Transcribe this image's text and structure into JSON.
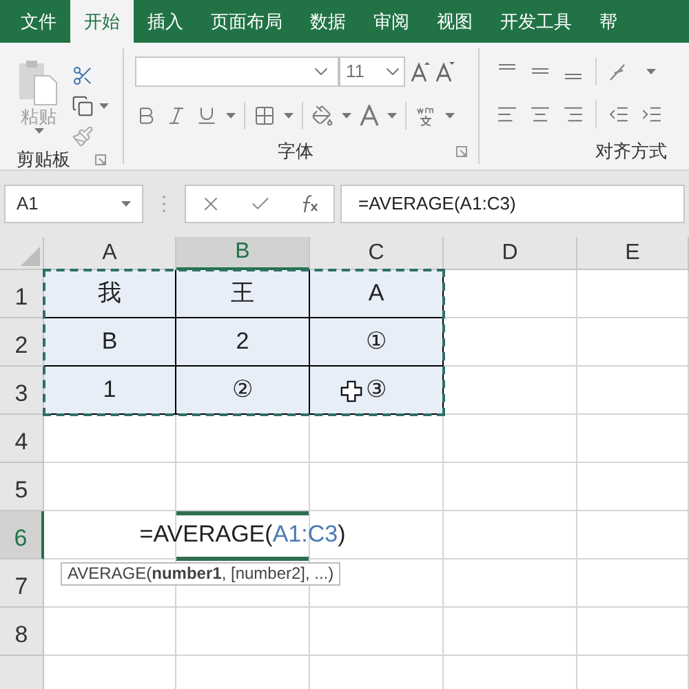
{
  "tabs": [
    {
      "label": "文件",
      "selected": false
    },
    {
      "label": "开始",
      "selected": true
    },
    {
      "label": "插入",
      "selected": false
    },
    {
      "label": "页面布局",
      "selected": false
    },
    {
      "label": "数据",
      "selected": false
    },
    {
      "label": "审阅",
      "selected": false
    },
    {
      "label": "视图",
      "selected": false
    },
    {
      "label": "开发工具",
      "selected": false
    },
    {
      "label": "帮",
      "selected": false
    }
  ],
  "ribbon": {
    "paste_label": "粘贴",
    "paste_disabled": true,
    "font_size": "11",
    "groups": [
      "剪贴板",
      "字体",
      "对齐方式"
    ]
  },
  "formula_bar": {
    "name_box": "A1",
    "formula": "=AVERAGE(A1:C3)"
  },
  "columns": [
    {
      "label": "A",
      "selected": false
    },
    {
      "label": "B",
      "selected": true
    },
    {
      "label": "C",
      "selected": false
    },
    {
      "label": "D",
      "selected": false
    },
    {
      "label": "E",
      "selected": false
    }
  ],
  "rows": [
    {
      "label": "1",
      "selected": false,
      "cells": [
        {
          "kind": "value",
          "text": "我",
          "highlighted": true
        },
        {
          "kind": "value",
          "text": "王",
          "highlighted": true
        },
        {
          "kind": "value",
          "text": "A",
          "highlighted": true
        },
        {
          "kind": "value"
        },
        {
          "kind": "value"
        }
      ]
    },
    {
      "label": "2",
      "selected": false,
      "cells": [
        {
          "kind": "value",
          "text": "B",
          "highlighted": true
        },
        {
          "kind": "value",
          "text": "2",
          "highlighted": true
        },
        {
          "kind": "value",
          "text": "①",
          "highlighted": true
        },
        {
          "kind": "value"
        },
        {
          "kind": "value"
        }
      ]
    },
    {
      "label": "3",
      "selected": false,
      "cells": [
        {
          "kind": "value",
          "text": "1",
          "highlighted": true
        },
        {
          "kind": "value",
          "text": "②",
          "highlighted": true
        },
        {
          "kind": "value",
          "text": "③",
          "highlighted": true,
          "cursor": true
        },
        {
          "kind": "value"
        },
        {
          "kind": "value"
        }
      ]
    },
    {
      "label": "4",
      "selected": false,
      "cells": [
        {
          "kind": "value"
        },
        {
          "kind": "value"
        },
        {
          "kind": "value"
        },
        {
          "kind": "value"
        },
        {
          "kind": "value"
        }
      ]
    },
    {
      "label": "5",
      "selected": false,
      "cells": [
        {
          "kind": "value"
        },
        {
          "kind": "value"
        },
        {
          "kind": "value"
        },
        {
          "kind": "value"
        },
        {
          "kind": "value"
        }
      ]
    },
    {
      "label": "6",
      "selected": true,
      "cells": [
        {
          "kind": "value"
        },
        {
          "kind": "editing",
          "prefix": "=AVERAGE(",
          "ref": "A1:C3",
          "suffix": ")",
          "tooltip": "AVERAGE(**number1**, [number2], ...)"
        },
        {
          "kind": "value"
        },
        {
          "kind": "value"
        },
        {
          "kind": "value"
        }
      ]
    },
    {
      "label": "7",
      "selected": false,
      "cells": [
        {
          "kind": "value"
        },
        {
          "kind": "value"
        },
        {
          "kind": "value"
        },
        {
          "kind": "value"
        },
        {
          "kind": "value"
        }
      ]
    },
    {
      "label": "8",
      "selected": false,
      "cells": [
        {
          "kind": "value"
        },
        {
          "kind": "value"
        },
        {
          "kind": "value"
        },
        {
          "kind": "value"
        },
        {
          "kind": "value"
        }
      ]
    }
  ]
}
